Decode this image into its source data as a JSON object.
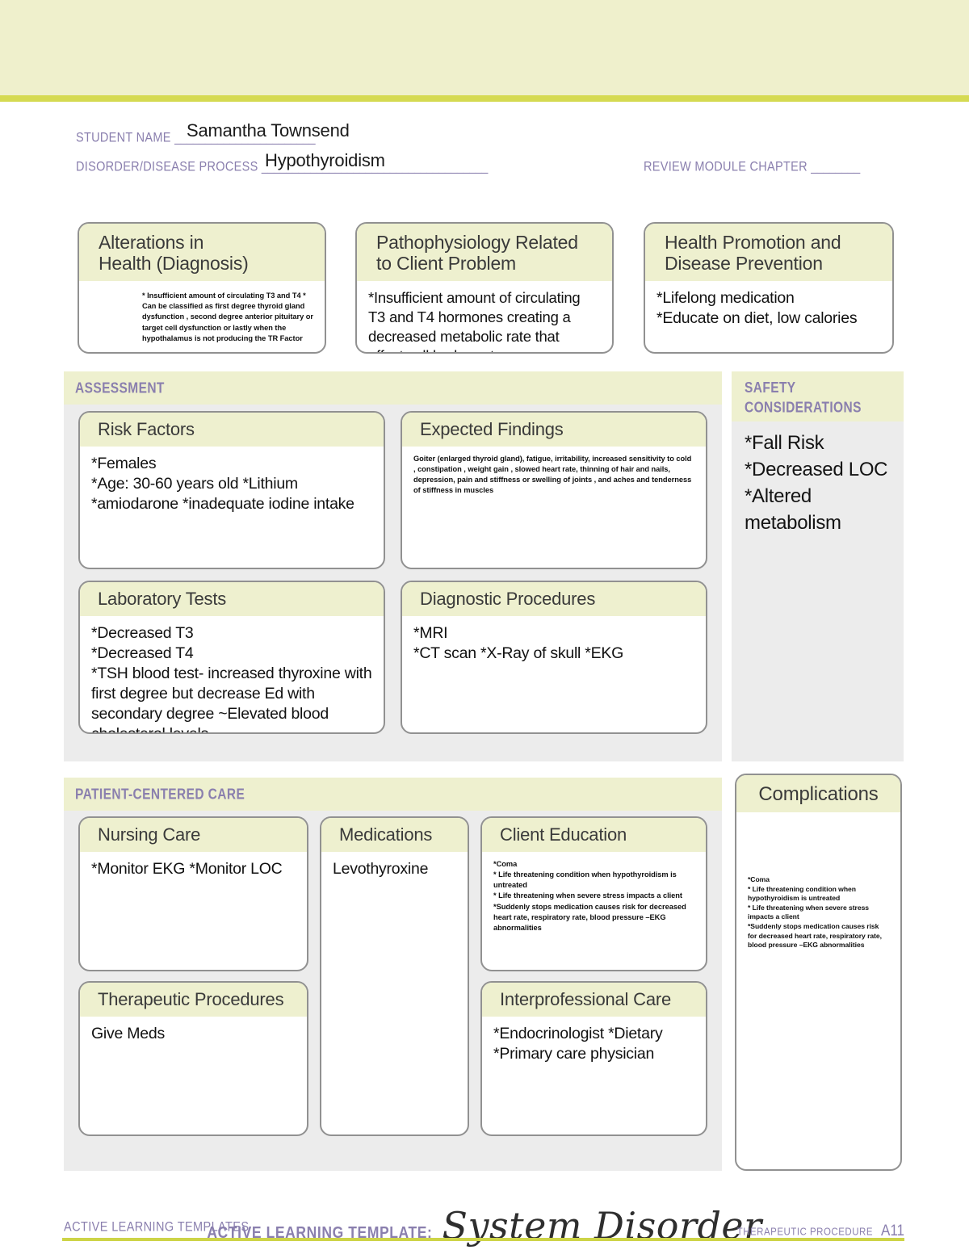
{
  "header": {
    "label": "ACTIVE LEARNING TEMPLATE:",
    "title": "System Disorder",
    "band_color": "#eff0cc",
    "rule_color": "#d5da52",
    "label_color": "#8a7fae"
  },
  "fields": {
    "student_name_label": "STUDENT NAME",
    "student_name_rule": "_______________________",
    "student_name_value": "Samantha Townsend",
    "disorder_label": "DISORDER/DISEASE PROCESS",
    "disorder_rule": "_____________________________________",
    "disorder_value": "Hypothyroidism",
    "chapter_label": "REVIEW MODULE CHAPTER",
    "chapter_rule": "________",
    "chapter_value": ""
  },
  "top_boxes": [
    {
      "id": "alterations",
      "title": "Alterations in\nHealth (Diagnosis)",
      "body": "* Insufficient amount of circulating T3 and T4 * Can be classified as first degree thyroid gland dysfunction , second degree anterior pituitary or target cell dysfunction or lastly when the hypothalamus is not producing the TR Factor"
    },
    {
      "id": "pathophysiology",
      "title": "Pathophysiology Related\nto Client Problem",
      "body": "*Insufficient amount of circulating T3 and T4 hormones creating a decreased metabolic rate that affects all body systems"
    },
    {
      "id": "health-promotion",
      "title": "Health Promotion and\nDisease Prevention",
      "body": "*Lifelong medication\n*Educate on diet, low calories"
    }
  ],
  "assessment": {
    "section_title": "ASSESSMENT",
    "boxes": [
      {
        "id": "risk-factors",
        "title": "Risk Factors",
        "body": "*Females\n*Age: 30-60 years old *Lithium\n*amiodarone *inadequate iodine intake"
      },
      {
        "id": "expected-findings",
        "title": "Expected Findings",
        "body": "Goiter (enlarged thyroid gland), fatigue, irritability, increased sensitivity to cold , constipation , weight gain , slowed heart rate, thinning of hair and nails, depression, pain and stiffness or swelling of joints , and aches and tenderness of stiffness in muscles"
      },
      {
        "id": "laboratory-tests",
        "title": "Laboratory Tests",
        "body": "*Decreased T3\n*Decreased T4\n*TSH blood test- increased thyroxine with first degree but decrease Ed with secondary degree ~Elevated blood cholesterol levels"
      },
      {
        "id": "diagnostic-procedures",
        "title": "Diagnostic Procedures",
        "body": "*MRI\n*CT scan *X-Ray of skull *EKG"
      }
    ]
  },
  "safety": {
    "section_title": "SAFETY\nCONSIDERATIONS",
    "body": "*Fall Risk\n*Decreased LOC\n*Altered metabolism"
  },
  "patient_centered_care": {
    "section_title": "PATIENT-CENTERED CARE",
    "boxes": [
      {
        "id": "nursing-care",
        "title": "Nursing Care",
        "body": "*Monitor EKG *Monitor LOC"
      },
      {
        "id": "therapeutic-procedures",
        "title": "Therapeutic Procedures",
        "body": "Give Meds"
      },
      {
        "id": "medications",
        "title": "Medications",
        "body": "Levothyroxine"
      },
      {
        "id": "client-education",
        "title": "Client Education",
        "body": "*Coma\n* Life threatening condition when hypothyroidism is untreated\n* Life threatening when severe stress impacts a client\n*Suddenly stops medication causes risk for decreased heart rate, respiratory rate, blood pressure –EKG abnormalities"
      },
      {
        "id": "interprofessional-care",
        "title": "Interprofessional Care",
        "body": "*Endocrinologist *Dietary\n*Primary care physician"
      }
    ]
  },
  "complications": {
    "title": "Complications",
    "body": "*Coma\n* Life threatening condition when hypothyroidism is untreated\n* Life threatening when severe stress impacts a client\n*Suddenly stops medication causes risk for decreased heart rate, respiratory rate, blood pressure –EKG abnormalities"
  },
  "footer": {
    "left": "ACTIVE LEARNING TEMPLATES",
    "right_label": "THERAPEUTIC PROCEDURE",
    "page": "A11",
    "rule_color": "#cdd447"
  }
}
